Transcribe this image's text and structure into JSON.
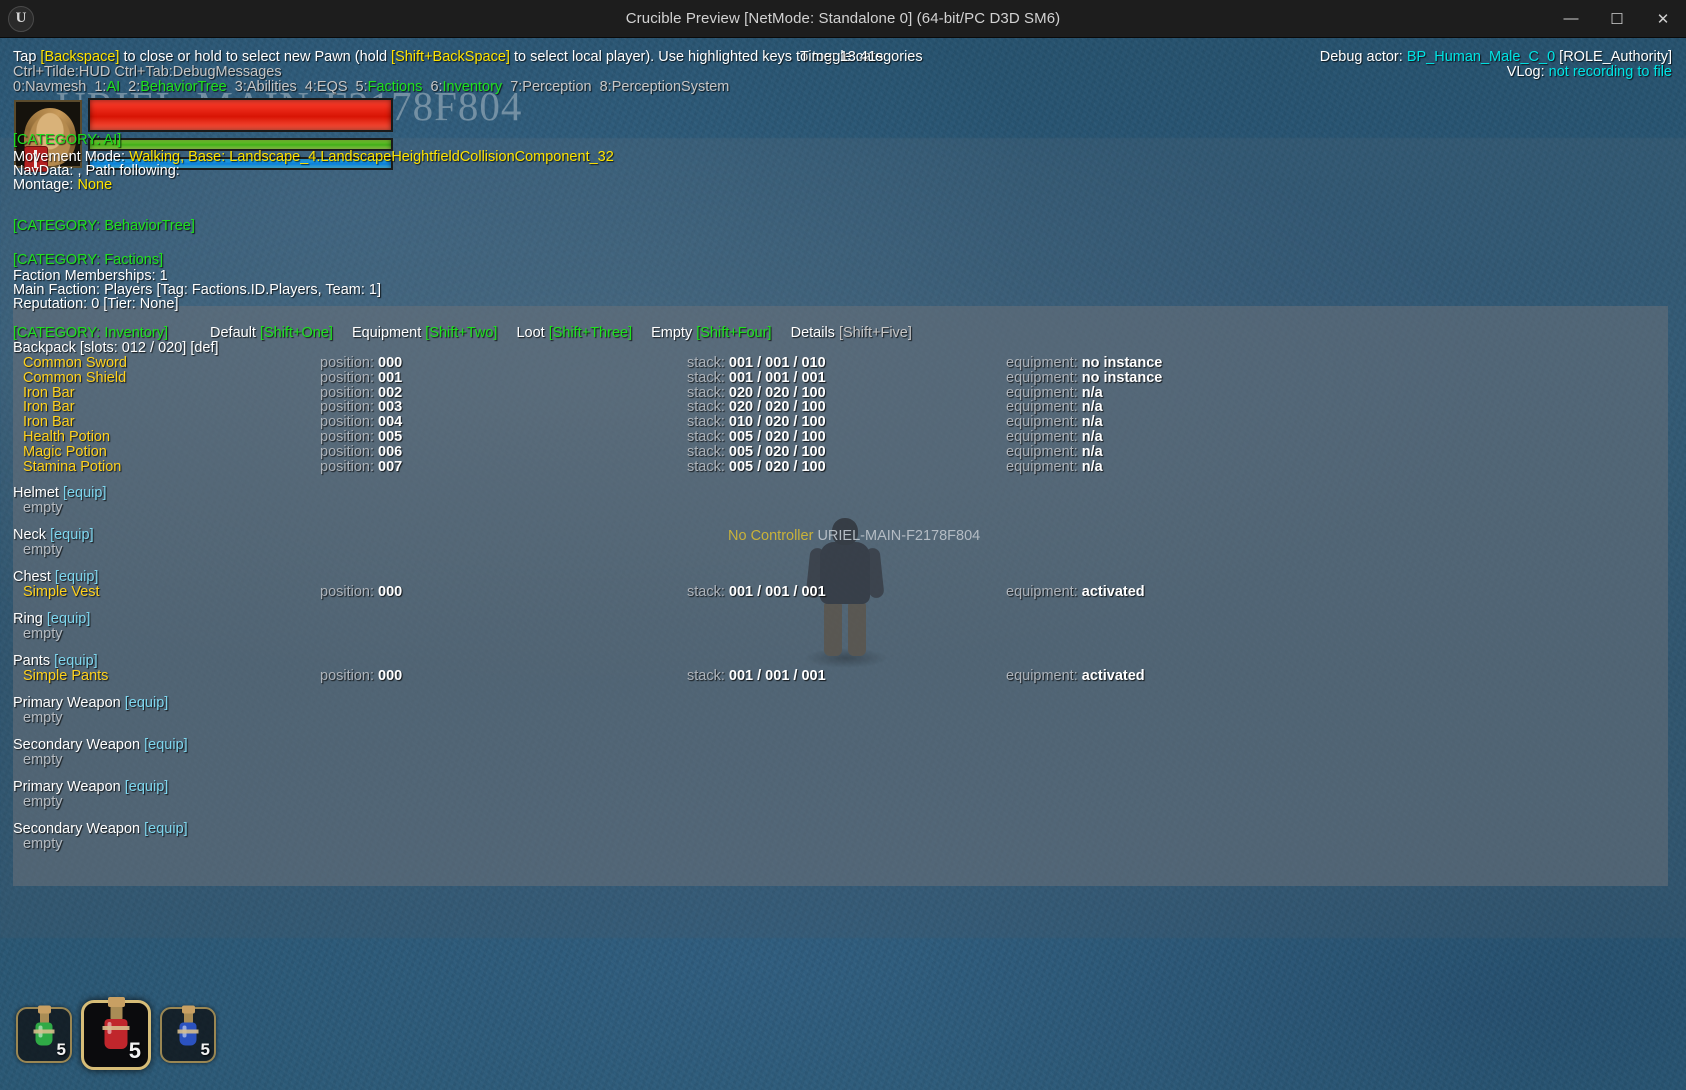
{
  "window": {
    "title": "Crucible Preview [NetMode: Standalone 0]  (64-bit/PC D3D SM6)",
    "logo_glyph": "U",
    "minimize_glyph": "—",
    "maximize_glyph": "☐",
    "close_glyph": "✕"
  },
  "hud": {
    "help_prefix": "Tap ",
    "help_key1": "[Backspace]",
    "help_mid": " to close or hold to select new Pawn (hold ",
    "help_key2": "[Shift+BackSpace]",
    "help_suffix": " to select local player). Use highlighted keys to toggle categories",
    "help_line2": "Ctrl+Tilde:HUD  Ctrl+Tab:DebugMessages",
    "time_label": "Time: 13.41s",
    "debug_actor_label": "Debug actor: ",
    "debug_actor_value": "BP_Human_Male_C_0",
    "debug_actor_role": " [ROLE_Authority]",
    "vlog_label": "VLog: ",
    "vlog_value": "not recording to file",
    "watermark": "URIEL-MAIN-F2178F804",
    "centre_no_controller": "No Controller",
    "centre_id": "URIEL-MAIN-F2178F804",
    "categories": [
      {
        "key": "0:",
        "name": "Navmesh",
        "active": false
      },
      {
        "key": "1:",
        "name": "AI",
        "active": true
      },
      {
        "key": "2:",
        "name": "BehaviorTree",
        "active": true
      },
      {
        "key": "3:",
        "name": "Abilities",
        "active": false
      },
      {
        "key": "4:",
        "name": "EQS",
        "active": false
      },
      {
        "key": "5:",
        "name": "Factions",
        "active": true
      },
      {
        "key": "6:",
        "name": "Inventory",
        "active": true
      },
      {
        "key": "7:",
        "name": "Perception",
        "active": false
      },
      {
        "key": "8:",
        "name": "PerceptionSystem",
        "active": false
      }
    ]
  },
  "ai": {
    "category": "[CATEGORY: AI]",
    "movement_label": "Movement Mode: ",
    "movement_value": "Walking, Base: Landscape_4.LandscapeHeightfieldCollisionComponent_32",
    "navdata": "NavData: , Path following:",
    "montage_label": "Montage: ",
    "montage_value": "None"
  },
  "behaviortree": {
    "category": "[CATEGORY: BehaviorTree]"
  },
  "factions": {
    "category": "[CATEGORY: Factions]",
    "memberships": "Faction Memberships: 1",
    "main_faction": "Main Faction: Players [Tag: Factions.ID.Players, Team: 1]",
    "reputation": "Reputation: 0 [Tier: None]"
  },
  "inventory": {
    "category": "[CATEGORY: Inventory]",
    "tabs": [
      {
        "label": "Default ",
        "key": "[Shift+One]",
        "key_active": true
      },
      {
        "label": "Equipment ",
        "key": "[Shift+Two]",
        "key_active": true
      },
      {
        "label": "Loot ",
        "key": "[Shift+Three]",
        "key_active": true
      },
      {
        "label": "Empty ",
        "key": "[Shift+Four]",
        "key_active": true
      },
      {
        "label": "Details ",
        "key": "[Shift+Five]",
        "key_active": false
      }
    ],
    "backpack_header": "Backpack [slots: 012 / 020] [def]",
    "columns": {
      "position": "position: ",
      "stack": "stack: ",
      "equipment": "equipment: "
    },
    "items": [
      {
        "name": "Common Sword",
        "position": "000",
        "stack": "001 / 001 / 010",
        "equipment": "no instance"
      },
      {
        "name": "Common Shield",
        "position": "001",
        "stack": "001 / 001 / 001",
        "equipment": "no instance"
      },
      {
        "name": "Iron Bar",
        "position": "002",
        "stack": "020 / 020 / 100",
        "equipment": "n/a"
      },
      {
        "name": "Iron Bar",
        "position": "003",
        "stack": "020 / 020 / 100",
        "equipment": "n/a"
      },
      {
        "name": "Iron Bar",
        "position": "004",
        "stack": "010 / 020 / 100",
        "equipment": "n/a"
      },
      {
        "name": "Health Potion",
        "position": "005",
        "stack": "005 / 020 / 100",
        "equipment": "n/a"
      },
      {
        "name": "Magic Potion",
        "position": "006",
        "stack": "005 / 020 / 100",
        "equipment": "n/a"
      },
      {
        "name": "Stamina Potion",
        "position": "007",
        "stack": "005 / 020 / 100",
        "equipment": "n/a"
      }
    ],
    "equip_tag": " [equip]",
    "empty_text": "empty",
    "slots": [
      {
        "slot": "Helmet",
        "filled": false,
        "item": "empty"
      },
      {
        "slot": "Neck",
        "filled": false,
        "item": "empty"
      },
      {
        "slot": "Chest",
        "filled": true,
        "item": "Simple Vest",
        "position": "000",
        "stack": "001 / 001 / 001",
        "equipment": "activated"
      },
      {
        "slot": "Ring",
        "filled": false,
        "item": "empty"
      },
      {
        "slot": "Pants",
        "filled": true,
        "item": "Simple Pants",
        "position": "000",
        "stack": "001 / 001 / 001",
        "equipment": "activated"
      },
      {
        "slot": "Primary Weapon",
        "filled": false,
        "item": "empty"
      },
      {
        "slot": "Secondary Weapon",
        "filled": false,
        "item": "empty"
      },
      {
        "slot": "Primary Weapon",
        "filled": false,
        "item": "empty"
      },
      {
        "slot": "Secondary Weapon",
        "filled": false,
        "item": "empty"
      }
    ]
  },
  "hotbar": {
    "slots": [
      {
        "name": "stamina-potion",
        "count": "5",
        "color": "#2faa46",
        "active": false
      },
      {
        "name": "health-potion",
        "count": "5",
        "color": "#c0262c",
        "active": true
      },
      {
        "name": "magic-potion",
        "count": "5",
        "color": "#2b52c0",
        "active": false
      }
    ]
  },
  "colors": {
    "highlight_green": "#1fe01f",
    "item_yellow": "#ffd21e",
    "equip_cyan": "#7fd7ef",
    "actor_cyan": "#00e5e5"
  }
}
